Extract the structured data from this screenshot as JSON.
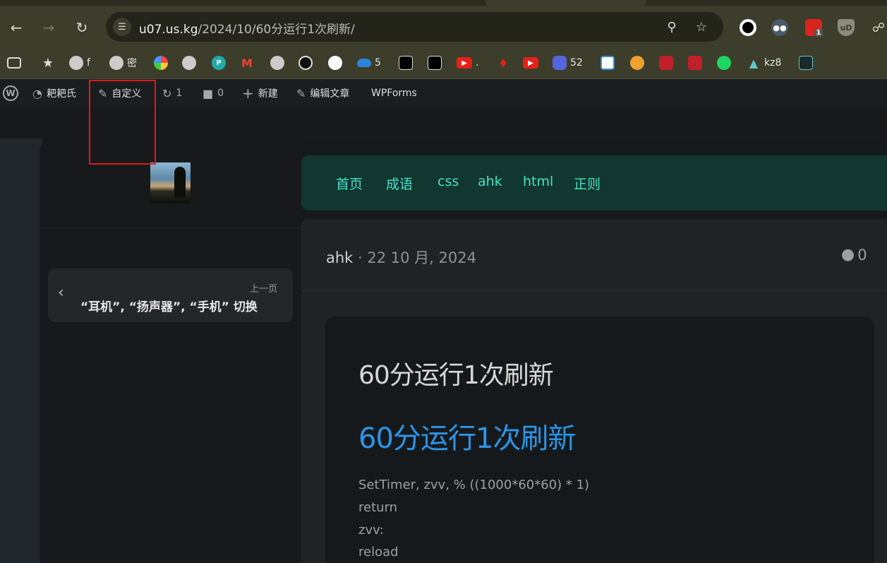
{
  "browser": {
    "url_host": "u07.us.kg",
    "url_path": "/2024/10/60分运行1次刷新/",
    "bookmarks": [
      {
        "label": "f"
      },
      {
        "label": "密"
      },
      {
        "label": "5"
      },
      {
        "label": "."
      },
      {
        "label": "52"
      },
      {
        "label": "kz8"
      }
    ],
    "extension_badge": "1"
  },
  "adminbar": {
    "site_name": "耙耙氏",
    "customize": "自定义",
    "updates": "1",
    "comments": "0",
    "new": "新建",
    "edit": "编辑文章",
    "wpforms": "WPForms"
  },
  "sidebar": {
    "prev_label": "上一页",
    "prev_title": "“耳机”, “扬声器”, “手机” 切换"
  },
  "nav": {
    "items": [
      "首页",
      "成语",
      "css",
      "ahk",
      "html",
      "正则"
    ]
  },
  "post": {
    "category": "ahk",
    "date": " · 22 10 月, 2024",
    "comment_count": "0",
    "title": "60分运行1次刷新",
    "heading": "60分运行1次刷新",
    "code_lines": [
      "SetTimer, zvv, % ((1000*60*60) * 1)",
      "return",
      "zvv:",
      "reload"
    ]
  }
}
